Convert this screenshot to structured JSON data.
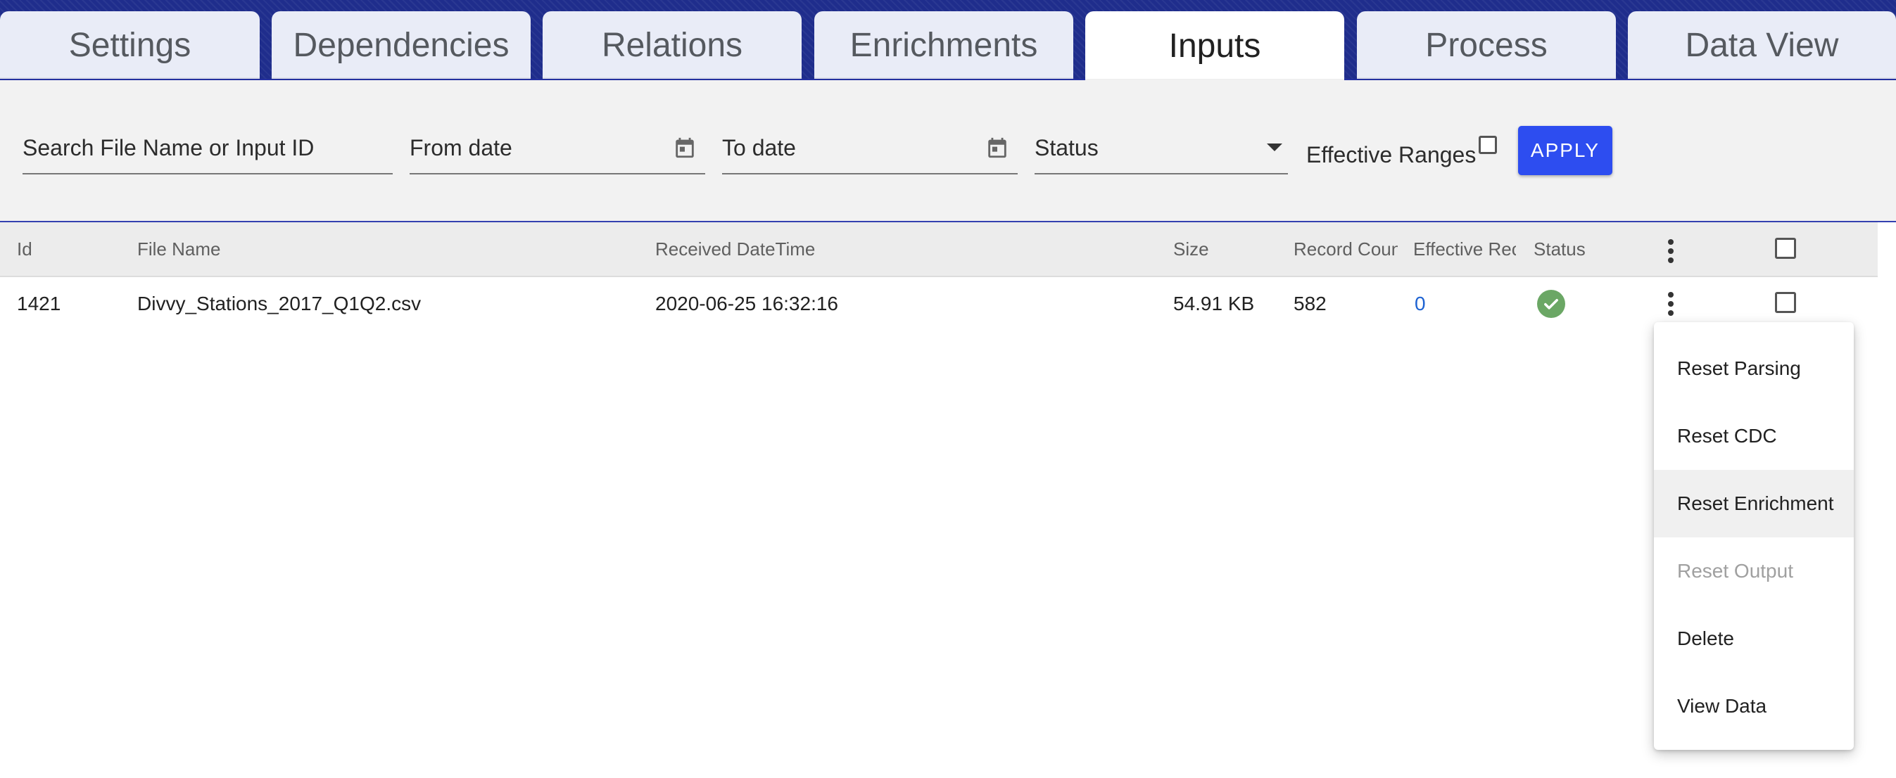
{
  "tabs": [
    {
      "label": "Settings"
    },
    {
      "label": "Dependencies"
    },
    {
      "label": "Relations"
    },
    {
      "label": "Enrichments"
    },
    {
      "label": "Inputs",
      "active": true
    },
    {
      "label": "Process"
    },
    {
      "label": "Data View"
    }
  ],
  "filters": {
    "search_placeholder": "Search File Name or Input ID",
    "from_date_placeholder": "From date",
    "to_date_placeholder": "To date",
    "status_placeholder": "Status",
    "effective_ranges_label": "Effective Ranges",
    "effective_ranges_checked": false,
    "apply_label": "APPLY"
  },
  "table": {
    "columns": [
      "Id",
      "File Name",
      "Received DateTime",
      "Size",
      "Record Coun",
      "Effective Rec",
      "Status"
    ],
    "rows": [
      {
        "id": "1421",
        "file_name": "Divvy_Stations_2017_Q1Q2.csv",
        "received": "2020-06-25 16:32:16",
        "size": "54.91 KB",
        "record_count": "582",
        "effective_records": "0",
        "status": "success",
        "selected": false
      }
    ]
  },
  "context_menu": {
    "items": [
      {
        "label": "Reset Parsing",
        "disabled": false
      },
      {
        "label": "Reset CDC",
        "disabled": false
      },
      {
        "label": "Reset Enrichment",
        "disabled": false,
        "hovered": true
      },
      {
        "label": "Reset Output",
        "disabled": true
      },
      {
        "label": "Delete",
        "disabled": false
      },
      {
        "label": "View Data",
        "disabled": false
      }
    ]
  },
  "colors": {
    "tabbar_bg": "#1f2d8c",
    "apply_button": "#2d4df0",
    "link": "#1e63d2",
    "status_ok": "#6ba765"
  },
  "icons": {
    "calendar": "calendar-icon",
    "dropdown": "caret-down-icon",
    "more": "kebab-menu-icon",
    "status": "check-circle-icon"
  }
}
